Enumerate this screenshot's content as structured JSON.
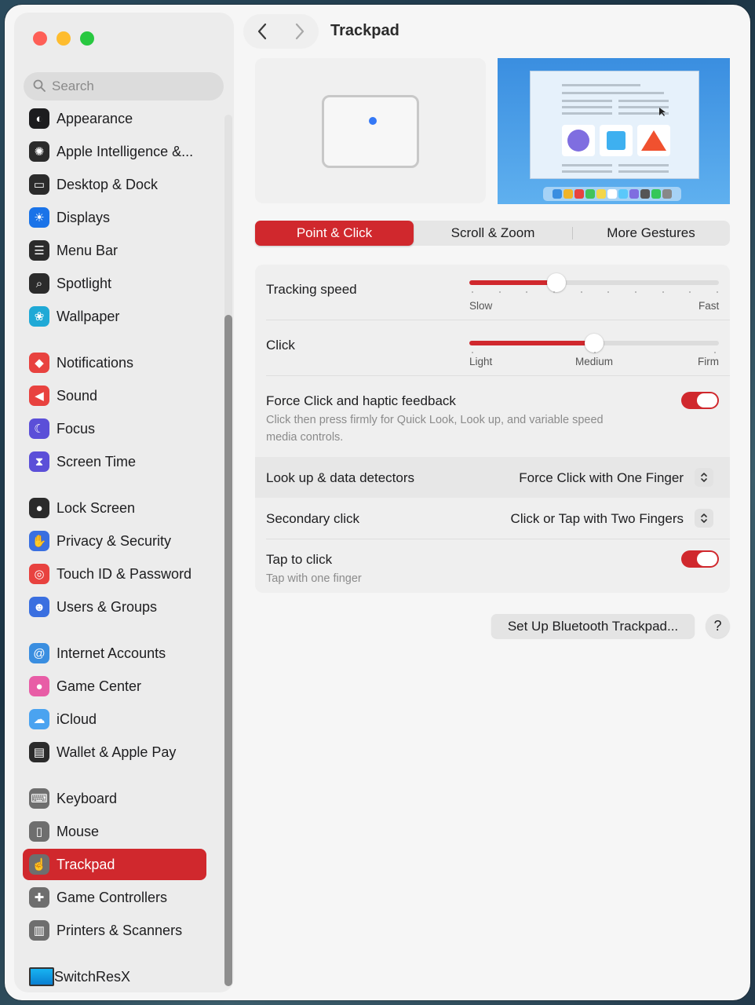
{
  "window": {
    "title": "Trackpad"
  },
  "search": {
    "placeholder": "Search"
  },
  "sidebar": {
    "items": [
      {
        "label": "Appearance",
        "icon": "appearance-icon",
        "color": "#1d1d1f"
      },
      {
        "label": "Apple Intelligence &...",
        "icon": "apple-intelligence-icon",
        "color": "#2b2b2b"
      },
      {
        "label": "Desktop & Dock",
        "icon": "desktop-dock-icon",
        "color": "#2b2b2b"
      },
      {
        "label": "Displays",
        "icon": "displays-icon",
        "color": "#1a73e8"
      },
      {
        "label": "Menu Bar",
        "icon": "menu-bar-icon",
        "color": "#2b2b2b"
      },
      {
        "label": "Spotlight",
        "icon": "spotlight-icon",
        "color": "#2b2b2b"
      },
      {
        "label": "Wallpaper",
        "icon": "wallpaper-icon",
        "color": "#1fa9d6"
      },
      {
        "label": "Notifications",
        "icon": "notifications-icon",
        "color": "#e8423f"
      },
      {
        "label": "Sound",
        "icon": "sound-icon",
        "color": "#e8423f"
      },
      {
        "label": "Focus",
        "icon": "focus-icon",
        "color": "#5b4fd8"
      },
      {
        "label": "Screen Time",
        "icon": "screen-time-icon",
        "color": "#5b4fd8"
      },
      {
        "label": "Lock Screen",
        "icon": "lock-screen-icon",
        "color": "#2b2b2b"
      },
      {
        "label": "Privacy & Security",
        "icon": "privacy-hand-icon",
        "color": "#3a6fe0"
      },
      {
        "label": "Touch ID & Password",
        "icon": "fingerprint-icon",
        "color": "#e8423f"
      },
      {
        "label": "Users & Groups",
        "icon": "users-icon",
        "color": "#3a6fe0"
      },
      {
        "label": "Internet Accounts",
        "icon": "at-sign-icon",
        "color": "#3a8ee0"
      },
      {
        "label": "Game Center",
        "icon": "game-center-icon",
        "color": "#e85da6"
      },
      {
        "label": "iCloud",
        "icon": "icloud-icon",
        "color": "#4aa3f0"
      },
      {
        "label": "Wallet & Apple Pay",
        "icon": "wallet-icon",
        "color": "#2b2b2b"
      },
      {
        "label": "Keyboard",
        "icon": "keyboard-icon",
        "color": "#6e6e6e"
      },
      {
        "label": "Mouse",
        "icon": "mouse-icon",
        "color": "#6e6e6e"
      },
      {
        "label": "Trackpad",
        "icon": "trackpad-icon",
        "color": "#6e6e6e",
        "selected": true
      },
      {
        "label": "Game Controllers",
        "icon": "game-controller-icon",
        "color": "#6e6e6e"
      },
      {
        "label": "Printers & Scanners",
        "icon": "printer-icon",
        "color": "#6e6e6e"
      },
      {
        "label": "SwitchResX",
        "icon": "switchresx-monitor-icon",
        "color": "#0a7fd1"
      }
    ]
  },
  "tabs": [
    {
      "label": "Point & Click",
      "active": true
    },
    {
      "label": "Scroll & Zoom",
      "active": false
    },
    {
      "label": "More Gestures",
      "active": false
    }
  ],
  "settings": {
    "tracking_speed": {
      "label": "Tracking speed",
      "min_label": "Slow",
      "max_label": "Fast",
      "value_fraction": 0.35
    },
    "click": {
      "label": "Click",
      "options": [
        "Light",
        "Medium",
        "Firm"
      ],
      "value_fraction": 0.5
    },
    "force_click": {
      "label": "Force Click and haptic feedback",
      "description_line1": "Click then press firmly for Quick Look, Look up, and variable speed",
      "description_line2": "media controls.",
      "on": true
    },
    "look_up": {
      "label": "Look up & data detectors",
      "value": "Force Click with One Finger"
    },
    "secondary_click": {
      "label": "Secondary click",
      "value": "Click or Tap with Two Fingers"
    },
    "tap_to_click": {
      "label": "Tap to click",
      "description": "Tap with one finger",
      "on": true
    }
  },
  "buttons": {
    "bluetooth": "Set Up Bluetooth Trackpad...",
    "help": "?"
  },
  "accent_color": "#d0282d"
}
